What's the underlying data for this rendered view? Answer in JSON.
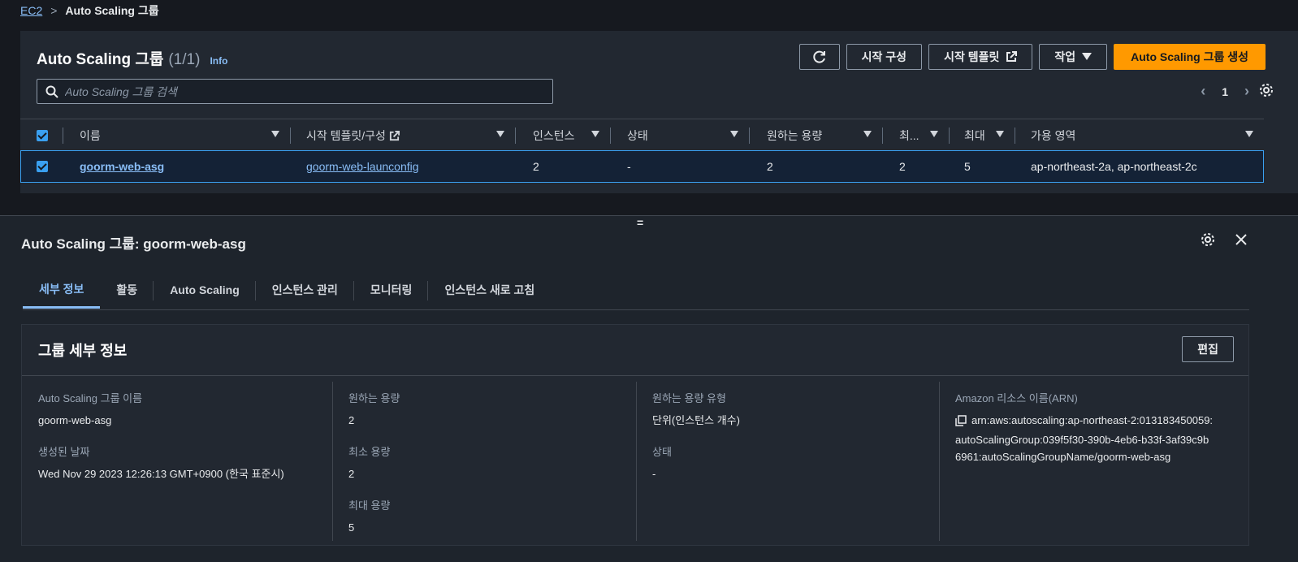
{
  "breadcrumb": {
    "root": "EC2",
    "current": "Auto Scaling 그룹"
  },
  "list": {
    "title": "Auto Scaling 그룹",
    "count": "(1/1)",
    "info": "Info",
    "buttons": {
      "launch_config": "시작 구성",
      "launch_template": "시작 템플릿",
      "actions": "작업",
      "create": "Auto Scaling 그룹 생성"
    },
    "search_placeholder": "Auto Scaling 그룹 검색",
    "page": "1",
    "columns": [
      "이름",
      "시작 템플릿/구성",
      "인스턴스",
      "상태",
      "원하는 용량",
      "최...",
      "최대",
      "가용 영역"
    ],
    "row": {
      "name": "goorm-web-asg",
      "launch": "goorm-web-launconfig",
      "instances": "2",
      "status": "-",
      "desired": "2",
      "min": "2",
      "max": "5",
      "az": "ap-northeast-2a, ap-northeast-2c"
    }
  },
  "detail": {
    "title": "Auto Scaling 그룹: goorm-web-asg",
    "tabs": [
      "세부 정보",
      "활동",
      "Auto Scaling",
      "인스턴스 관리",
      "모니터링",
      "인스턴스 새로 고침"
    ],
    "card_title": "그룹 세부 정보",
    "edit": "편집",
    "fields": {
      "asg_name_label": "Auto Scaling 그룹 이름",
      "asg_name": "goorm-web-asg",
      "created_label": "생성된 날짜",
      "created": "Wed Nov 29 2023 12:26:13 GMT+0900 (한국 표준시)",
      "desired_label": "원하는 용량",
      "desired": "2",
      "min_label": "최소 용량",
      "min": "2",
      "max_label": "최대 용량",
      "max": "5",
      "desired_type_label": "원하는 용량 유형",
      "desired_type": "단위(인스턴스 개수)",
      "status_label": "상태",
      "status": "-",
      "arn_label": "Amazon 리소스 이름(ARN)",
      "arn_1": "arn:aws:autoscaling:ap-northeast-2:013183450059:",
      "arn_2": "autoScalingGroup:039f5f30-390b-4eb6-b33f-3af39c9b",
      "arn_3": "6961:autoScalingGroupName/goorm-web-asg"
    }
  }
}
